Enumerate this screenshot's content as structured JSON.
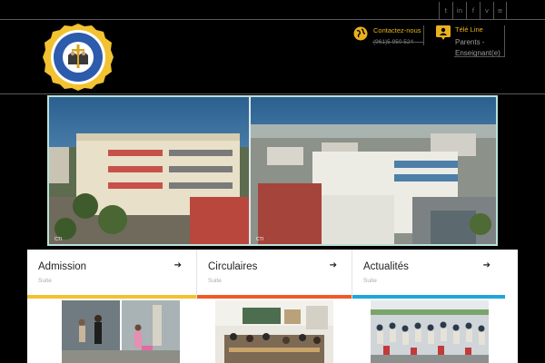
{
  "social": {
    "icons": [
      {
        "name": "twitter-icon",
        "glyph": "t"
      },
      {
        "name": "linkedin-icon",
        "glyph": "in"
      },
      {
        "name": "facebook-icon",
        "glyph": "f"
      },
      {
        "name": "vimeo-icon",
        "glyph": "v"
      },
      {
        "name": "rss-icon",
        "glyph": "≡"
      }
    ]
  },
  "header": {
    "contact_title": "Contactez-nous",
    "contact_phone": "(961)5 950 524",
    "teleline_title": "Télé Line",
    "teleline_sub": "Parents - Enseignant(e)"
  },
  "cards": [
    {
      "title": "Admission",
      "sub": "Suite",
      "arrow": "➔",
      "bar_color": "#f2c230"
    },
    {
      "title": "Circulaires",
      "sub": "Suite",
      "arrow": "➔",
      "bar_color": "#f05a28"
    },
    {
      "title": "Actualités",
      "sub": "Suite",
      "arrow": "➔",
      "bar_color": "#1fa6d8"
    }
  ],
  "colors": {
    "accent": "#e8b21f",
    "hero_border": "#b9e2dc"
  }
}
